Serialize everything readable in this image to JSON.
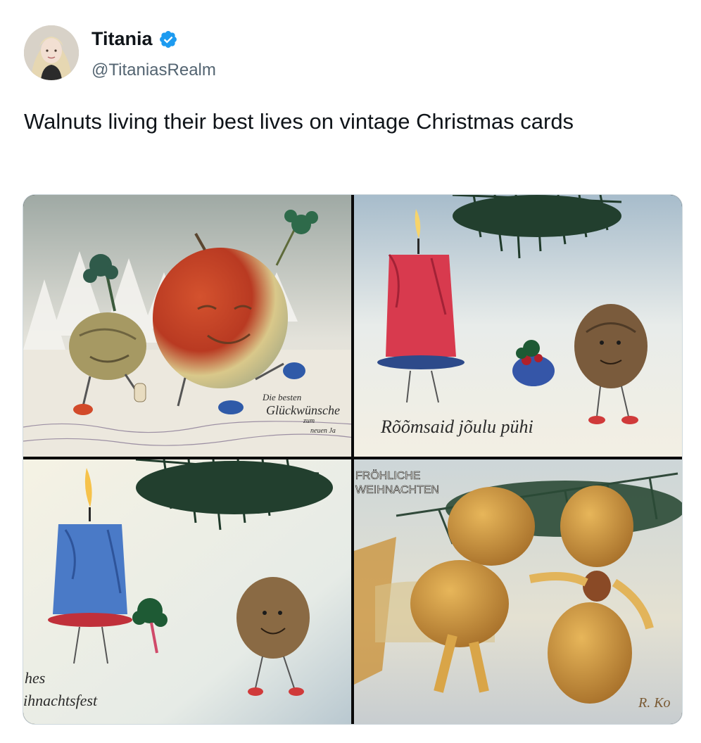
{
  "tweet": {
    "author": {
      "display_name": "Titania",
      "handle": "@TitaniasRealm",
      "verified": true,
      "verified_icon": "verified-badge-icon",
      "verified_color": "#1d9bf0"
    },
    "text": "Walnuts living their best lives on vintage Christmas cards"
  },
  "media": {
    "images": [
      {
        "greeting_lines": [
          "Die besten",
          "Glückwünsche",
          "zum",
          "neuen Ja"
        ]
      },
      {
        "greeting_lines": [
          "Rõõmsaid jõulu pühi"
        ]
      },
      {
        "greeting_lines": [
          "hes",
          "ihnachtsfest"
        ]
      },
      {
        "greeting_lines": [
          "FRÖHLICHE",
          "WEIHNACHTEN"
        ],
        "signature": "R. Ko"
      }
    ]
  }
}
